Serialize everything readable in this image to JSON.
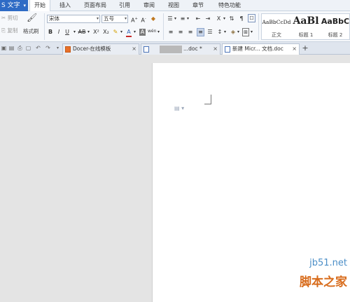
{
  "app": {
    "name": "S 文字",
    "colors": {
      "app_button": "#2e6bc5",
      "ribbon": "#f6f8fb",
      "workspace": "#e4e4e4",
      "page": "#ffffff"
    }
  },
  "menu": {
    "tabs": [
      "开始",
      "插入",
      "页面布局",
      "引用",
      "审阅",
      "视图",
      "章节",
      "特色功能"
    ],
    "active": "开始"
  },
  "ribbon": {
    "clipboard": {
      "cut": "剪切",
      "copy": "复制",
      "format_painter": "格式刷"
    },
    "font": {
      "name": "宋体",
      "size": "五号",
      "tools": [
        "B",
        "I",
        "U",
        "AB",
        "X²",
        "X₂",
        "A",
        "A",
        "wén"
      ]
    },
    "styles": [
      {
        "sample": "AaBbCcDd",
        "label": "正文"
      },
      {
        "sample": "AaBl",
        "label": "标题 1"
      },
      {
        "sample": "AaBbC",
        "label": "标题 2"
      }
    ]
  },
  "tabbar": {
    "tabs": [
      {
        "label": "Docer-在线模板",
        "icon": "docer-icon"
      },
      {
        "label": "...doc *",
        "icon": "document-icon"
      },
      {
        "label": "新建 Micr... 文档.doc",
        "icon": "document-icon",
        "active": true
      }
    ],
    "add": "+"
  },
  "watermark": {
    "line1": "jb51.net",
    "line2": "脚本之家"
  }
}
